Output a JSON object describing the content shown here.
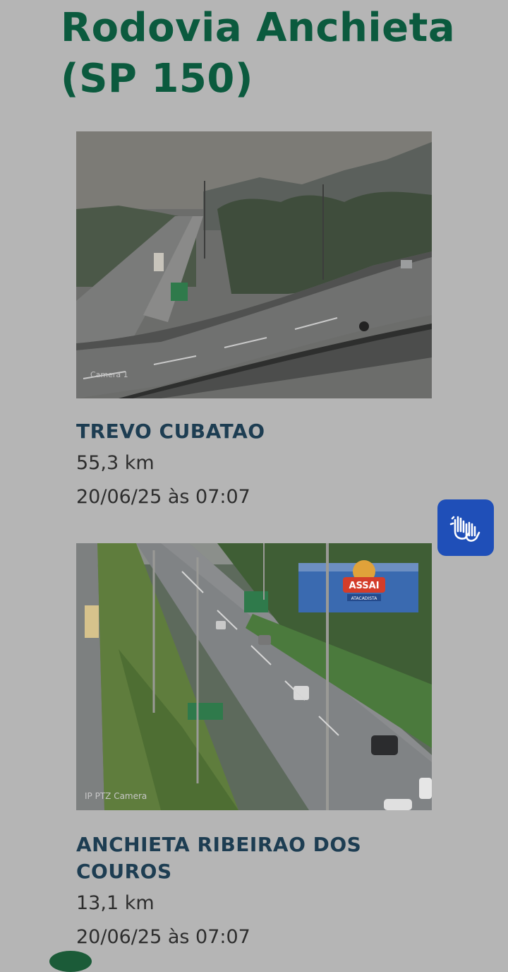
{
  "page": {
    "title": "Rodovia Anchieta (SP 150)"
  },
  "cameras": [
    {
      "name": "TREVO CUBATAO",
      "km": "55,3 km",
      "updated": "20/06/25 às 07:07",
      "overlay_label": "Camera 1",
      "image_description": "Foggy highway interchange with overpass"
    },
    {
      "name": "ANCHIETA RIBEIRAO DOS COUROS",
      "km": "13,1 km",
      "updated": "20/06/25 às 07:07",
      "overlay_label": "IP PTZ Camera",
      "sign_text": "ASSAI",
      "sign_subtext": "ATACADISTA"
    }
  ],
  "accessibility": {
    "icon": "sign-language-hands-icon",
    "color": "#1f4fb8"
  },
  "colors": {
    "title": "#0b5a3e",
    "camera_name": "#1d3d52",
    "background": "#b5b5b5"
  }
}
